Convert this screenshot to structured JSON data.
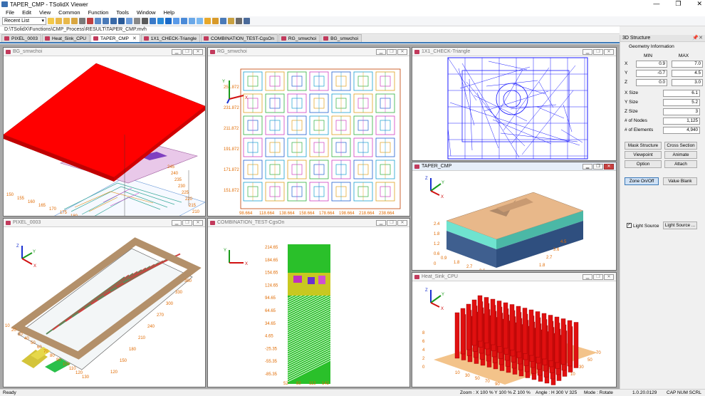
{
  "window": {
    "title": "TAPER_CMP - TSolidX Viewer",
    "controls": [
      "—",
      "❐",
      "✕"
    ]
  },
  "menu": [
    "File",
    "Edit",
    "View",
    "Common",
    "Function",
    "Tools",
    "Window",
    "Help"
  ],
  "toolbar": {
    "recent_label": "Recent List"
  },
  "path": "D:\\TSolidX\\Functions\\CMP_Process\\RESULT\\TAPER_CMP.mvh",
  "tabs": [
    {
      "label": "PIXEL_0003",
      "active": false
    },
    {
      "label": "Heat_Sink_CPU",
      "active": false
    },
    {
      "label": "TAPER_CMP",
      "active": true
    },
    {
      "label": "1X1_CHECK-Triangle",
      "active": false
    },
    {
      "label": "COMBINATION_TEST-CgsOn",
      "active": false
    },
    {
      "label": "RG_smwchoi",
      "active": false
    },
    {
      "label": "BG_smwchoi",
      "active": false
    }
  ],
  "windows": {
    "bg": {
      "title": "BG_smwchoi",
      "x_ticks": [
        "150",
        "155",
        "160",
        "165",
        "170",
        "175",
        "180",
        "185"
      ],
      "y_ticks": [
        "210",
        "215",
        "220",
        "225",
        "230",
        "235",
        "240",
        "245"
      ]
    },
    "rg": {
      "title": "RG_smwchoi",
      "y_ticks": [
        "251.872",
        "231.872",
        "211.872",
        "191.872",
        "171.872",
        "151.872"
      ],
      "x_ticks": [
        "98.664",
        "118.664",
        "138.664",
        "158.664",
        "178.664",
        "198.664",
        "218.664",
        "238.664"
      ]
    },
    "check": {
      "title": "1X1_CHECK-Triangle"
    },
    "taper": {
      "title": "TAPER_CMP",
      "z_ticks": [
        "2.4",
        "1.8",
        "1.2",
        "0.6",
        "0"
      ],
      "x_ticks": [
        "0.9",
        "1.8",
        "2.7",
        "3.6"
      ],
      "y_ticks": [
        "1.8",
        "2.7",
        "3.6",
        "4.5"
      ]
    },
    "pixel": {
      "title": "PIXEL_0003",
      "x_ticks": [
        "10",
        "20",
        "30",
        "40",
        "50",
        "60",
        "70",
        "80",
        "90",
        "100",
        "110",
        "120",
        "130"
      ],
      "y_ticks": [
        "120",
        "150",
        "180",
        "210",
        "240",
        "270",
        "300",
        "330",
        "360"
      ]
    },
    "combo": {
      "title": "COMBINATION_TEST-CgsOn",
      "y_ticks": [
        "214.65",
        "184.65",
        "154.65",
        "124.65",
        "94.65",
        "64.65",
        "34.65",
        "4.65",
        "-25.35",
        "-55.35",
        "-85.35"
      ],
      "x_ticks": [
        "52",
        "82",
        "112",
        "142"
      ]
    },
    "heat": {
      "title": "Heat_Sink_CPU",
      "z_ticks": [
        "8",
        "6",
        "4",
        "2",
        "0"
      ],
      "x_ticks": [
        "10",
        "30",
        "50",
        "70",
        "90"
      ],
      "y_ticks": [
        "10",
        "30",
        "50",
        "70"
      ]
    }
  },
  "axis_labels": {
    "x": "X",
    "y": "Y",
    "z": "Z"
  },
  "panel": {
    "title": "3D Structure",
    "geometry_title": "Geometry Information",
    "min_label": "MIN",
    "max_label": "MAX",
    "rows": [
      {
        "axis": "X",
        "min": "0.9",
        "max": "7.0"
      },
      {
        "axis": "Y",
        "min": "-0.7",
        "max": "4.5"
      },
      {
        "axis": "Z",
        "min": "0.0",
        "max": "3.0"
      }
    ],
    "info": [
      {
        "label": "X Size",
        "value": "6.1"
      },
      {
        "label": "Y Size",
        "value": "5.2"
      },
      {
        "label": "Z Size",
        "value": "3"
      },
      {
        "label": "# of Nodes",
        "value": "1,125"
      },
      {
        "label": "# of Elements",
        "value": "4,940"
      }
    ],
    "buttons": [
      "Mask Structure",
      "Cross Section",
      "Viewpoint",
      "Animate",
      "Option",
      "Attach"
    ],
    "zone_button": "Zone On/Off",
    "value_blank_button": "Value Blank",
    "light_source_check": "Light Source",
    "light_source_button": "Light Source ..."
  },
  "status": {
    "left": "Ready",
    "zoom": "Zoom : X 100 %  Y 100 %  Z 100 %",
    "angle": "Angle : H 300  V 325",
    "mode": "Mode : Rotate",
    "version": "1.0.20.0129",
    "caps": "CAP  NUM  SCRL"
  },
  "colors": {
    "accent": "#3c7ab8",
    "mesh_blue": "#1a1aff",
    "red": "#e01010",
    "orange": "#e06a00"
  }
}
